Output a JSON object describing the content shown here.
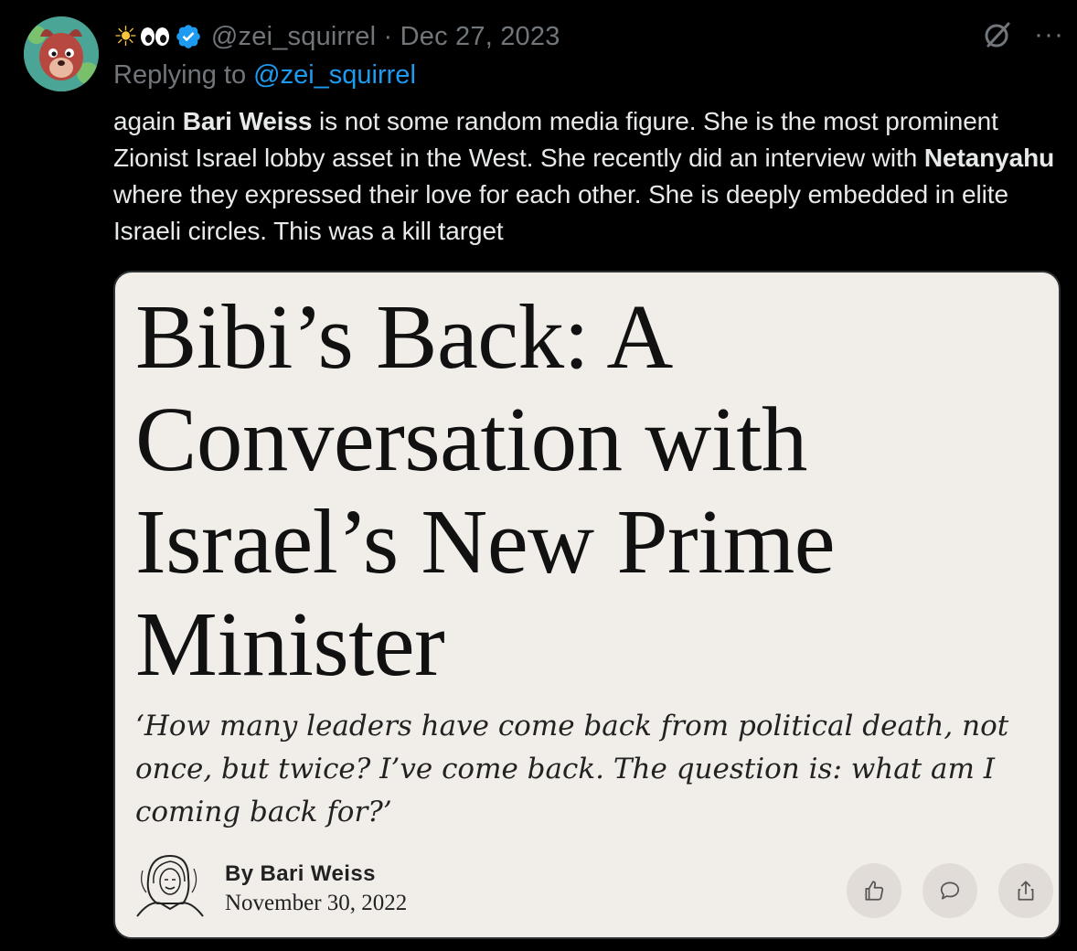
{
  "tweet": {
    "display_name_icons": [
      "sun-emoji",
      "eyes-emoji",
      "verified-badge"
    ],
    "handle": "@zei_squirrel",
    "separator": " · ",
    "date": "Dec 27, 2023",
    "replying_prefix": "Replying to ",
    "replying_to": "@zei_squirrel",
    "text_parts": {
      "p1": "again ",
      "b1": "Bari Weiss",
      "p2": " is not some random media figure. She is the most prominent Zionist Israel lobby asset in the West. She recently did an interview with ",
      "b2": "Netanyahu",
      "p3": " where they expressed their love for each other. She is deeply embedded in elite Israeli circles. This was a kill target"
    }
  },
  "card": {
    "headline": "Bibi’s Back: A Conversation with Israel’s New Prime Minister",
    "dek": "‘How many leaders have come back from political death, not once, but twice? I’ve come back. The question is: what am I coming back for?’",
    "byline": "By Bari Weiss",
    "date": "November 30, 2022",
    "actions": [
      "like-icon",
      "comment-icon",
      "share-icon"
    ]
  },
  "colors": {
    "background": "#000000",
    "text": "#e7e9ea",
    "muted": "#71767b",
    "link": "#1d9bf0",
    "card_bg": "#f1eeea",
    "verified": "#1d9bf0"
  }
}
